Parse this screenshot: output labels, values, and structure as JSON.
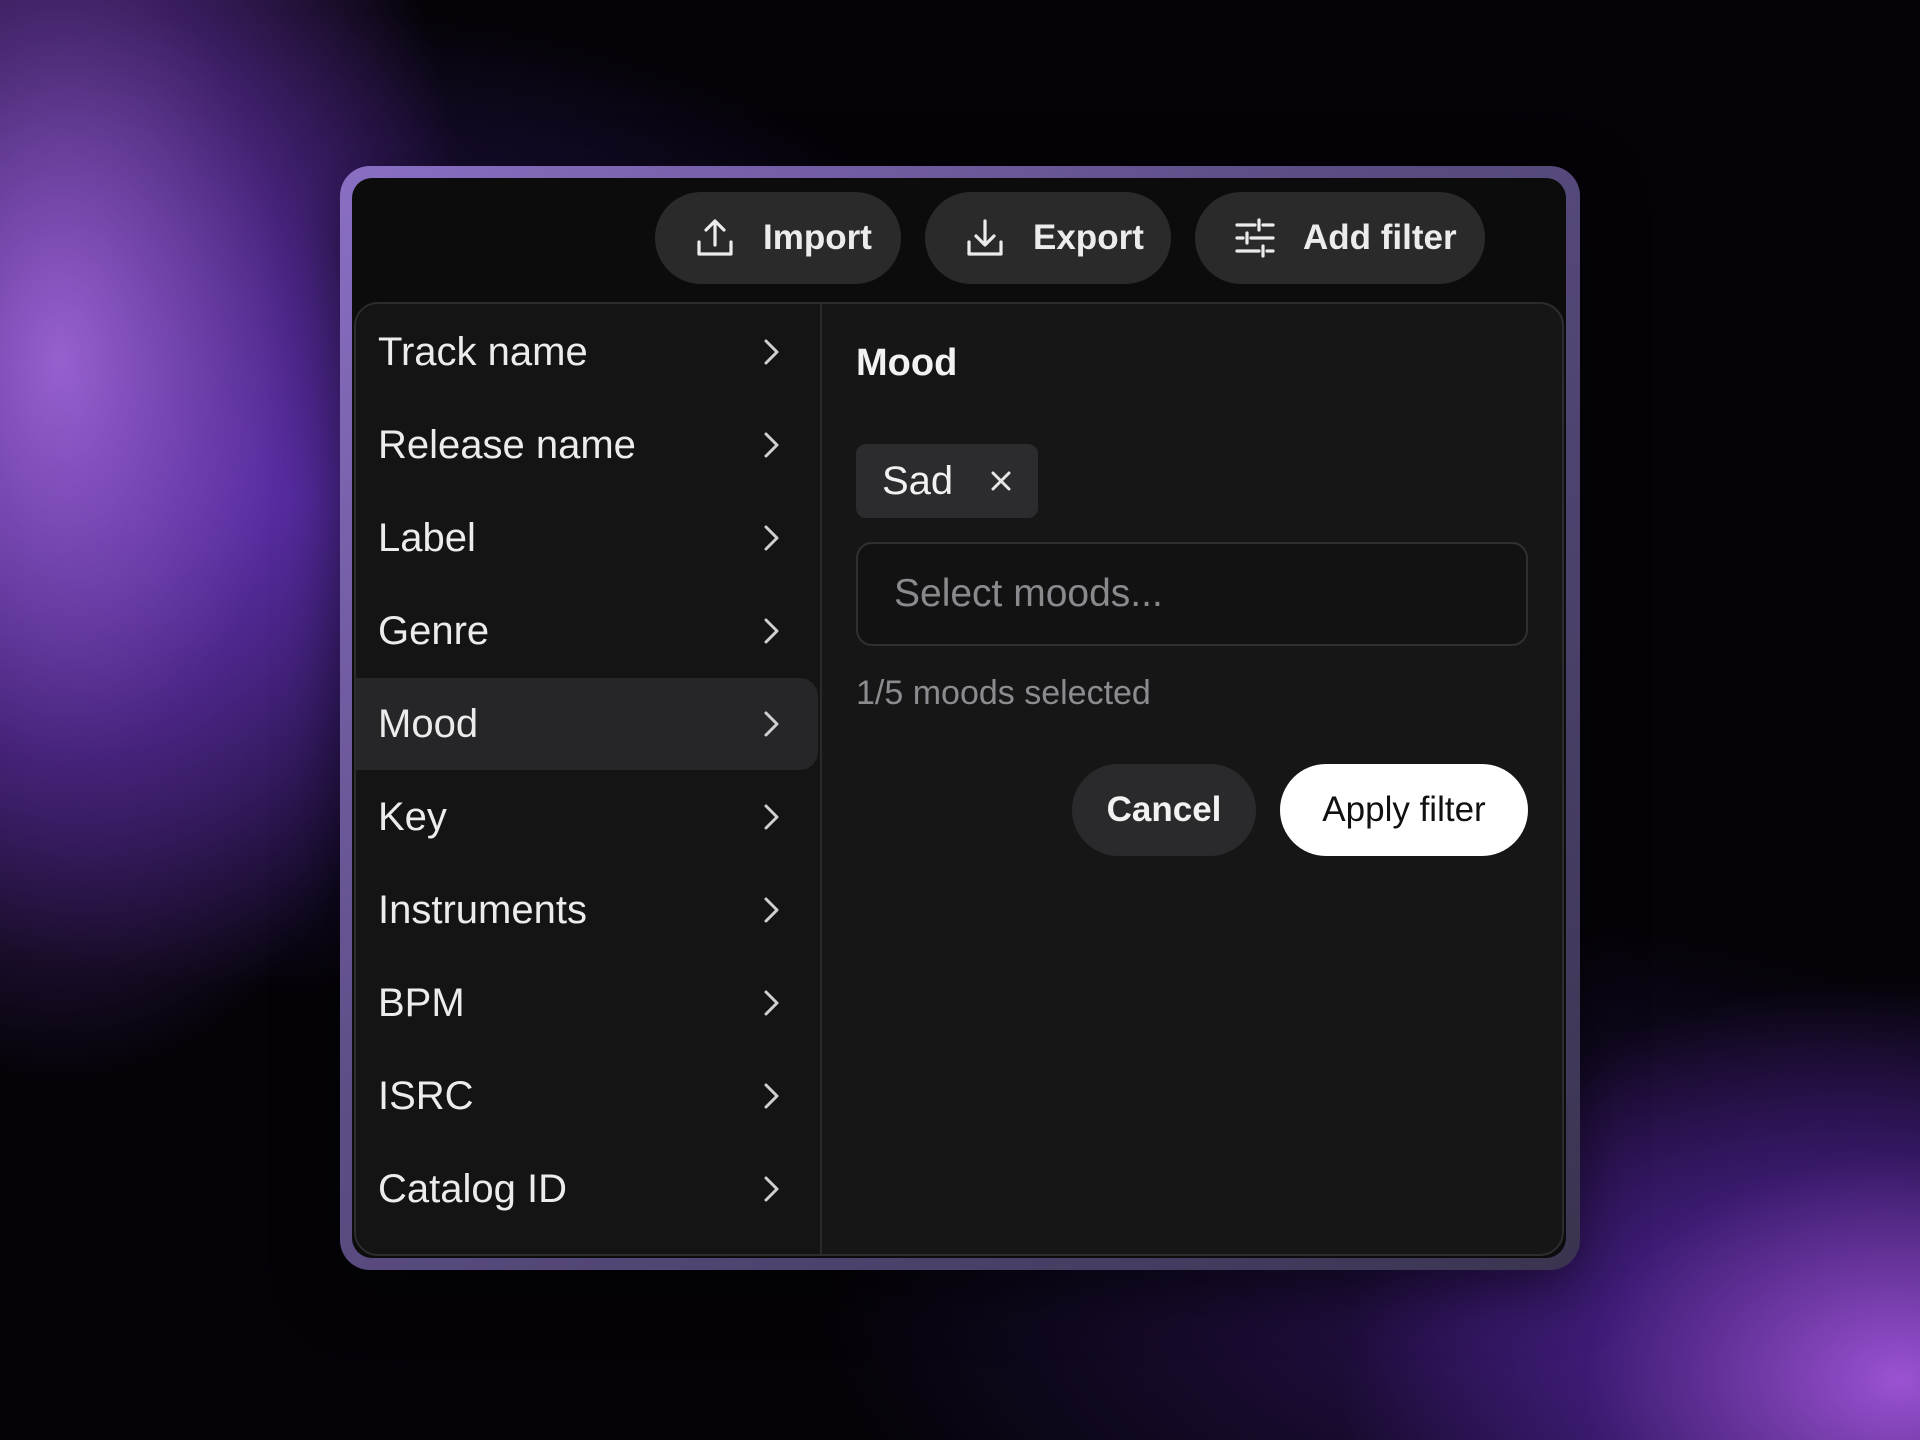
{
  "toolbar": {
    "import_label": "Import",
    "export_label": "Export",
    "add_filter_label": "Add filter"
  },
  "sidebar": {
    "items": [
      {
        "label": "Track name"
      },
      {
        "label": "Release name"
      },
      {
        "label": "Label"
      },
      {
        "label": "Genre"
      },
      {
        "label": "Mood",
        "active": true
      },
      {
        "label": "Key"
      },
      {
        "label": "Instruments"
      },
      {
        "label": "BPM"
      },
      {
        "label": "ISRC"
      },
      {
        "label": "Catalog ID"
      }
    ]
  },
  "filter": {
    "title": "Mood",
    "selected_chips": [
      "Sad"
    ],
    "select_placeholder": "Select moods...",
    "count_text": "1/5 moods selected",
    "cancel_label": "Cancel",
    "apply_label": "Apply filter"
  },
  "icons": {
    "import": "upload-icon",
    "export": "download-icon",
    "add_filter": "sliders-icon",
    "chevron": "chevron-right-icon",
    "remove": "close-icon"
  },
  "colors": {
    "window_bg": "#0c0c0d",
    "panel_bg": "#161617",
    "button_bg": "#2a2a2b",
    "primary_button_bg": "#ffffff",
    "text": "#ececec",
    "muted_text": "#8c8c90",
    "frame_accent": "#8a6fc4"
  }
}
